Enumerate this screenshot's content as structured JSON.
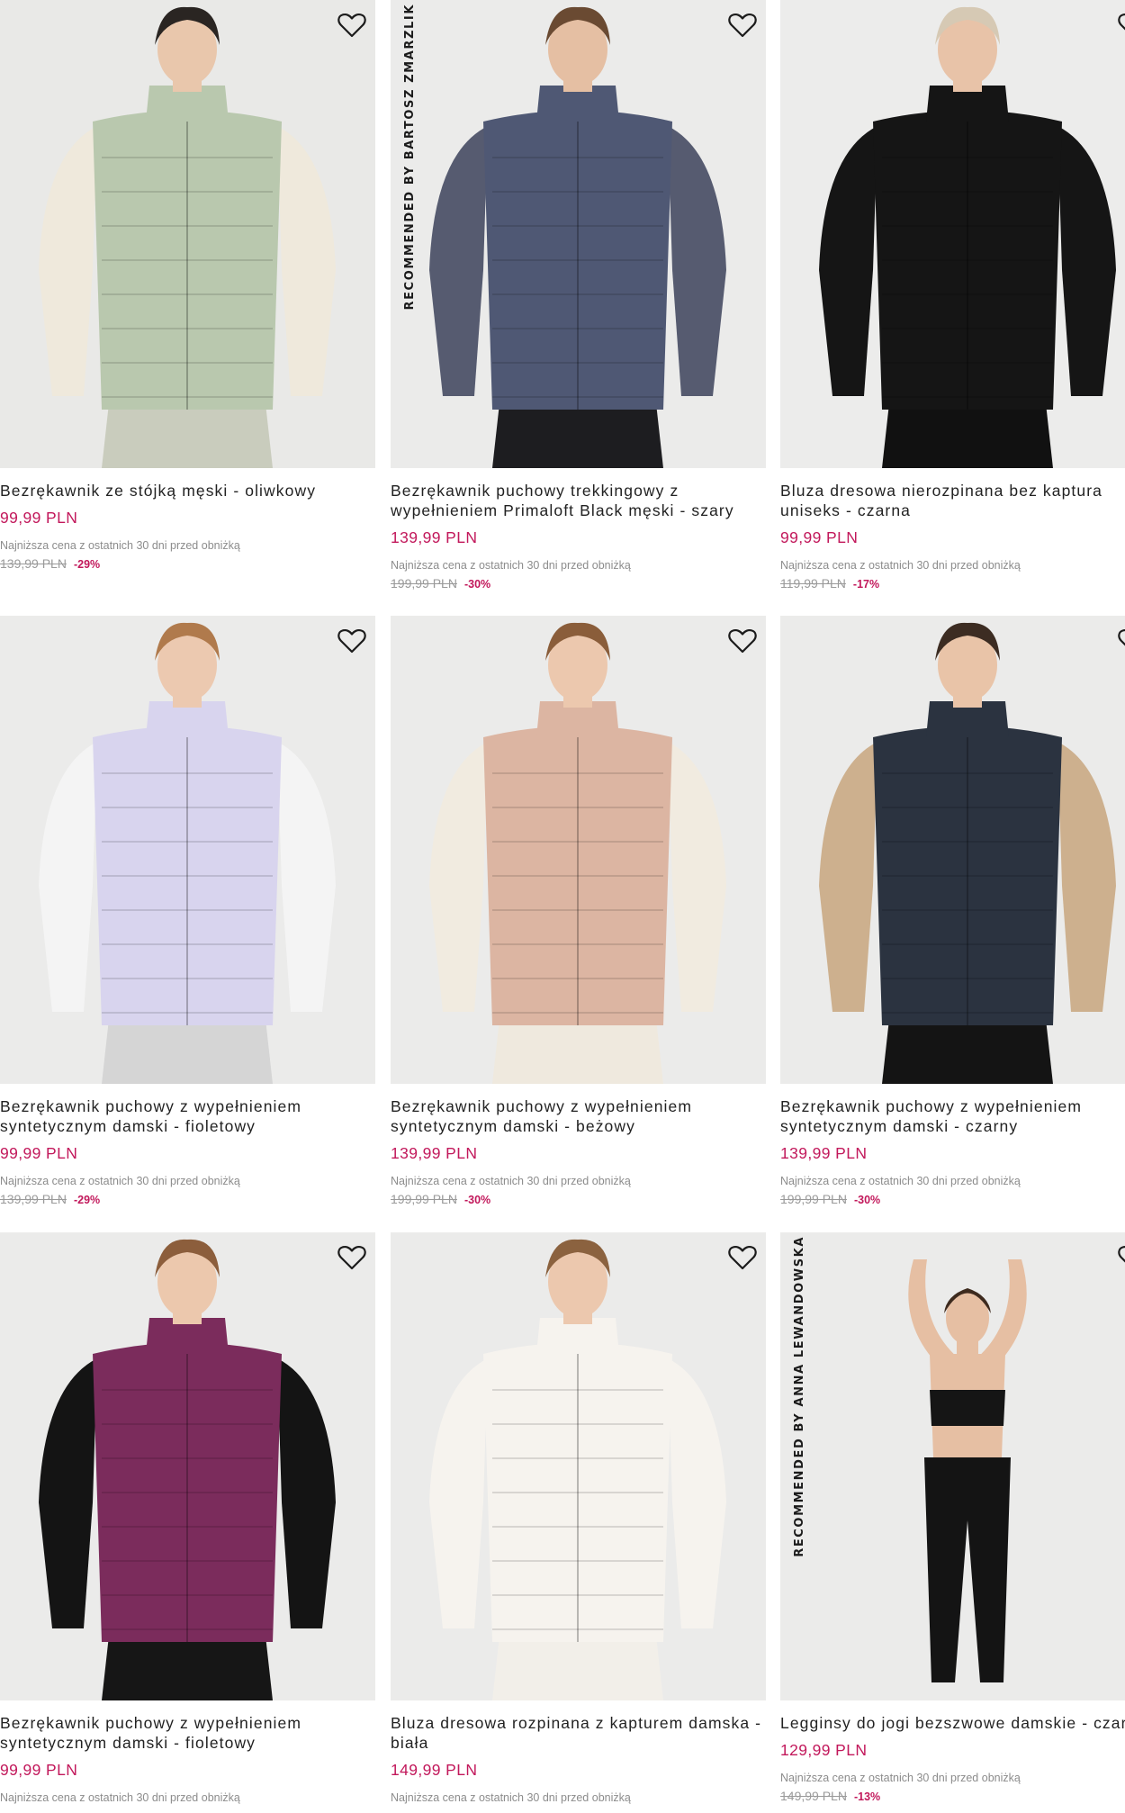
{
  "products": [
    {
      "title": "Bezrękawnik ze stójką męski - oliwkowy",
      "price": "99,99 PLN",
      "lowest_note": "Najniższa cena z ostatnich 30 dni przed obniżką",
      "old_price": "139,99 PLN",
      "discount": "-29%",
      "recommended": "",
      "colors": {
        "bg": "#e9e9e7",
        "garment": "#b9c8ae",
        "sleeve": "#efe9dc",
        "skin": "#e9c7ac",
        "hair": "#2a2522",
        "legs": "#c9ccbd"
      }
    },
    {
      "title": "Bezrękawnik puchowy trekkingowy z wypełnieniem Primaloft Black męski - szary",
      "price": "139,99 PLN",
      "lowest_note": "Najniższa cena z ostatnich 30 dni przed obniżką",
      "old_price": "199,99 PLN",
      "discount": "-30%",
      "recommended": "RECOMMENDED BY BARTOSZ ZMARZLIK",
      "colors": {
        "bg": "#ebebea",
        "garment": "#4f5874",
        "sleeve": "#565b70",
        "skin": "#e5bfa3",
        "hair": "#6a4a32",
        "legs": "#1d1d20"
      }
    },
    {
      "title": "Bluza dresowa nierozpinana bez kaptura uniseks - czarna",
      "price": "99,99 PLN",
      "lowest_note": "Najniższa cena z ostatnich 30 dni przed obniżką",
      "old_price": "119,99 PLN",
      "discount": "-17%",
      "recommended": "",
      "colors": {
        "bg": "#ececeb",
        "garment": "#151515",
        "sleeve": "#151515",
        "skin": "#e8c3a8",
        "hair": "#d6c9b4",
        "legs": "#111111"
      }
    },
    {
      "title": "Bezrękawnik puchowy z wypełnieniem syntetycznym damski - fioletowy",
      "price": "99,99 PLN",
      "lowest_note": "Najniższa cena z ostatnich 30 dni przed obniżką",
      "old_price": "139,99 PLN",
      "discount": "-29%",
      "recommended": "",
      "colors": {
        "bg": "#ebebea",
        "garment": "#d8d4ee",
        "sleeve": "#f4f4f4",
        "skin": "#ecc9b0",
        "hair": "#b07a4c",
        "legs": "#d5d5d5"
      }
    },
    {
      "title": "Bezrękawnik puchowy z wypełnieniem syntetycznym damski - beżowy",
      "price": "139,99 PLN",
      "lowest_note": "Najniższa cena z ostatnich 30 dni przed obniżką",
      "old_price": "199,99 PLN",
      "discount": "-30%",
      "recommended": "",
      "colors": {
        "bg": "#ebebea",
        "garment": "#dcb5a2",
        "sleeve": "#f1ebe0",
        "skin": "#ecc8ae",
        "hair": "#8a5d3a",
        "legs": "#efe9de"
      }
    },
    {
      "title": "Bezrękawnik puchowy z wypełnieniem syntetycznym damski - czarny",
      "price": "139,99 PLN",
      "lowest_note": "Najniższa cena z ostatnich 30 dni przed obniżką",
      "old_price": "199,99 PLN",
      "discount": "-30%",
      "recommended": "",
      "colors": {
        "bg": "#ebebea",
        "garment": "#2b3340",
        "sleeve": "#cdb08e",
        "skin": "#e9c4a8",
        "hair": "#3c2c22",
        "legs": "#141414"
      }
    },
    {
      "title": "Bezrękawnik puchowy z wypełnieniem syntetycznym damski - fioletowy",
      "price": "99,99 PLN",
      "lowest_note": "Najniższa cena z ostatnich 30 dni przed obniżką",
      "old_price": "",
      "discount": "",
      "recommended": "",
      "colors": {
        "bg": "#ebebea",
        "garment": "#7b2c5c",
        "sleeve": "#141414",
        "skin": "#ecc8ad",
        "hair": "#8c5e3c",
        "legs": "#161616"
      }
    },
    {
      "title": "Bluza dresowa rozpinana z kapturem damska - biała",
      "price": "149,99 PLN",
      "lowest_note": "Najniższa cena z ostatnich 30 dni przed obniżką",
      "old_price": "",
      "discount": "",
      "recommended": "",
      "colors": {
        "bg": "#ebebea",
        "garment": "#f6f3ee",
        "sleeve": "#f6f3ee",
        "skin": "#ecc8ae",
        "hair": "#8b623f",
        "legs": "#f2efe9"
      }
    },
    {
      "title": "Legginsy do jogi bezszwowe damskie - czarne",
      "price": "129,99 PLN",
      "lowest_note": "Najniższa cena z ostatnich 30 dni przed obniżką",
      "old_price": "149,99 PLN",
      "discount": "-13%",
      "recommended": "RECOMMENDED BY ANNA LEWANDOWSKA",
      "colors": {
        "bg": "#ebebea",
        "garment": "#151515",
        "sleeve": "#e6bfa3",
        "skin": "#e6bfa3",
        "hair": "#3d2a1e",
        "legs": "#141414"
      }
    }
  ],
  "icons": {
    "favorite": "heart-outline-icon"
  }
}
